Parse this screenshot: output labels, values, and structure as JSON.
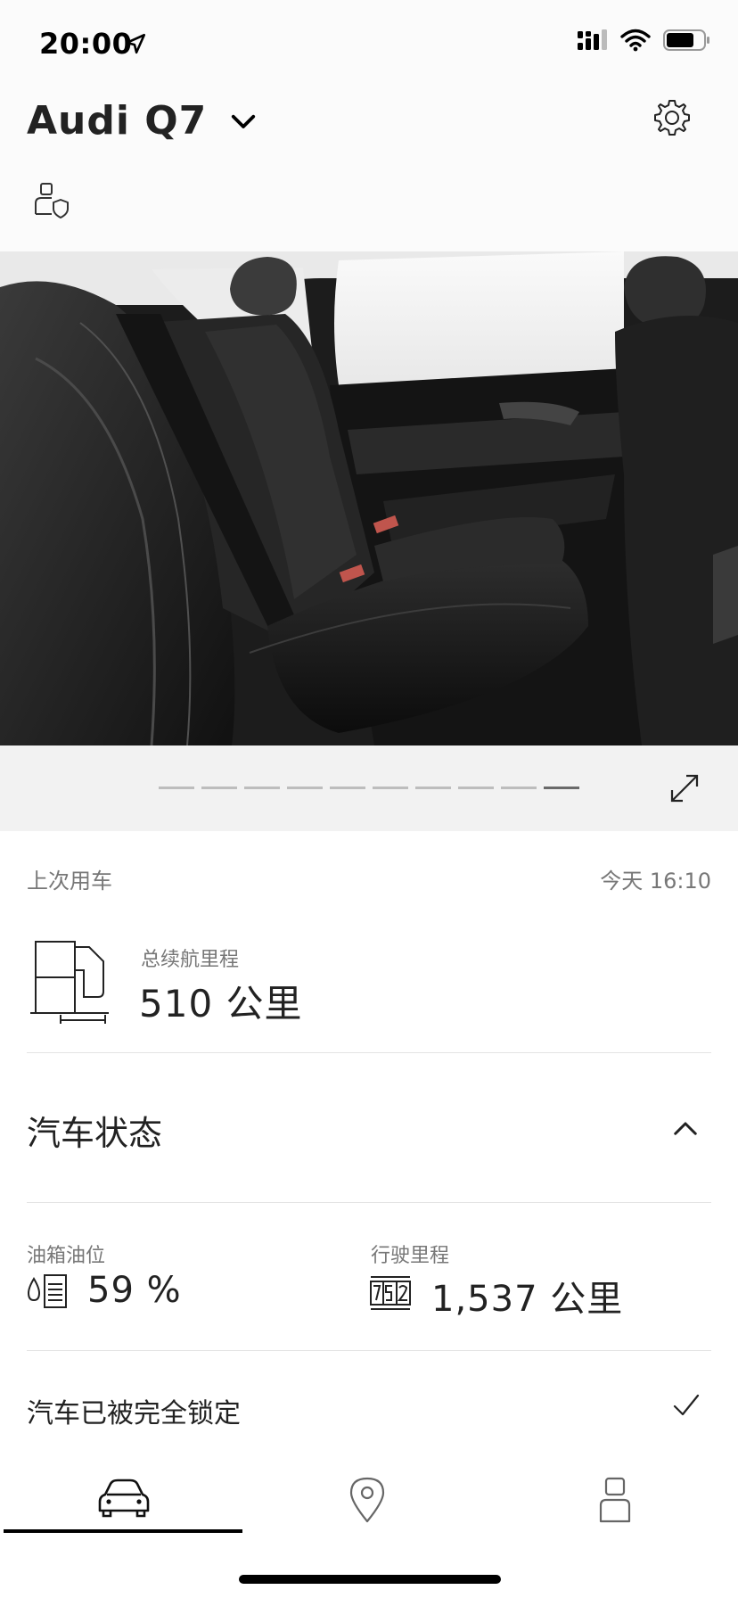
{
  "status_bar": {
    "time": "20:00"
  },
  "header": {
    "car_name": "Audi Q7"
  },
  "carousel": {
    "total": 10,
    "active_index": 9
  },
  "last_use": {
    "label": "上次用车",
    "time": "今天 16:10"
  },
  "range": {
    "label": "总续航里程",
    "value": "510 公里"
  },
  "vehicle_status": {
    "title": "汽车状态",
    "fuel": {
      "label": "油箱油位",
      "value": "59 %"
    },
    "mileage": {
      "label": "行驶里程",
      "value": "1,537 公里"
    },
    "lock_status": "汽车已被完全锁定"
  },
  "tabbar": {
    "items": [
      {
        "icon": "car-icon",
        "active": true
      },
      {
        "icon": "location-pin-icon",
        "active": false
      },
      {
        "icon": "person-icon",
        "active": false
      }
    ]
  }
}
